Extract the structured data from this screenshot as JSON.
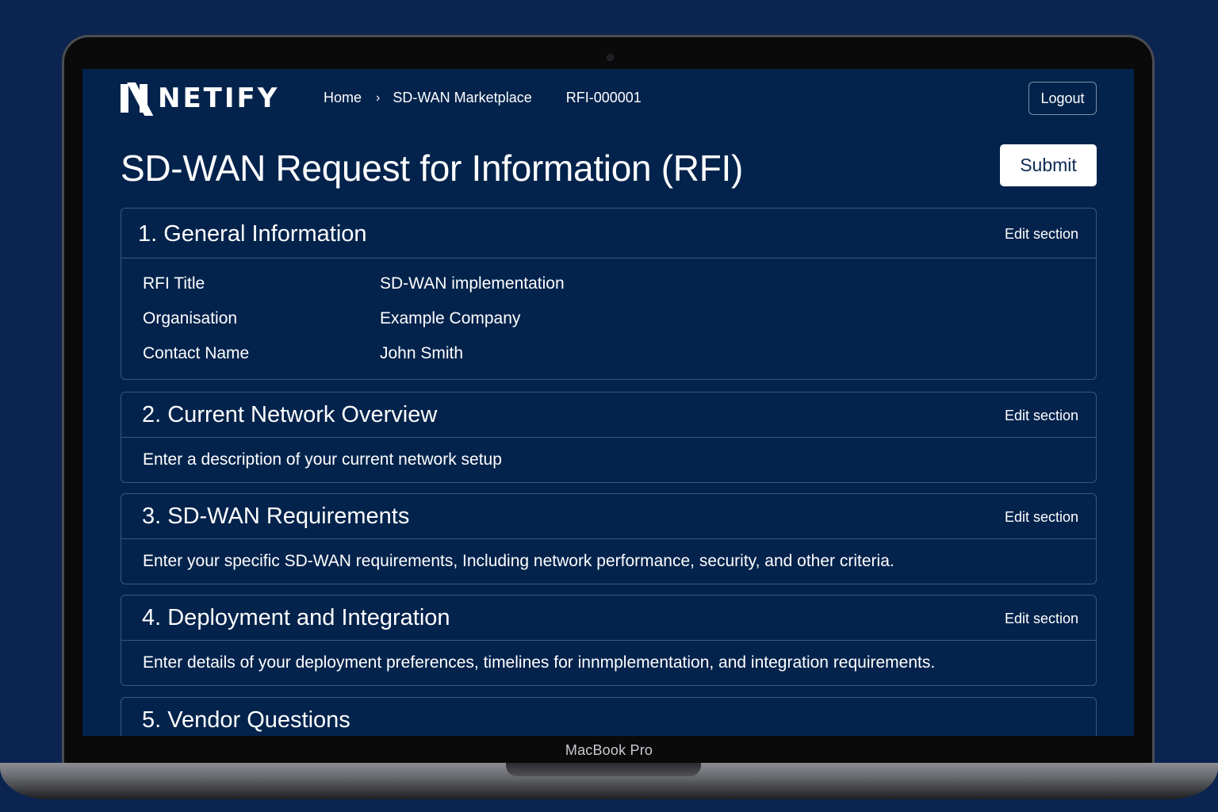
{
  "brand": {
    "name": "NETIFY"
  },
  "breadcrumb": [
    "Home",
    "SD-WAN Marketplace",
    "RFI-000001"
  ],
  "header": {
    "logout_label": "Logout"
  },
  "page": {
    "title": "SD-WAN Request for Information (RFI)",
    "submit_label": "Submit"
  },
  "sections": [
    {
      "title": "1. General Information",
      "edit_label": "Edit section",
      "fields": [
        {
          "label": "RFI Title",
          "value": "SD-WAN implementation"
        },
        {
          "label": "Organisation",
          "value": "Example Company"
        },
        {
          "label": "Contact Name",
          "value": "John Smith"
        }
      ]
    },
    {
      "title": "2. Current Network Overview",
      "edit_label": "Edit section",
      "description": "Enter a description of your current network setup"
    },
    {
      "title": "3. SD-WAN Requirements",
      "edit_label": "Edit section",
      "description": "Enter your specific SD-WAN requirements, Including network performance, security, and other criteria."
    },
    {
      "title": "4. Deployment and Integration",
      "edit_label": "Edit section",
      "description": "Enter details of your deployment preferences, timelines for innmplementation, and integration requirements."
    },
    {
      "title": "5. Vendor Questions"
    }
  ],
  "device": {
    "label": "MacBook Pro"
  },
  "colors": {
    "background": "#0b2550",
    "screen": "#03234c",
    "border": "#3a5680",
    "submit_text": "#0e2a53"
  }
}
